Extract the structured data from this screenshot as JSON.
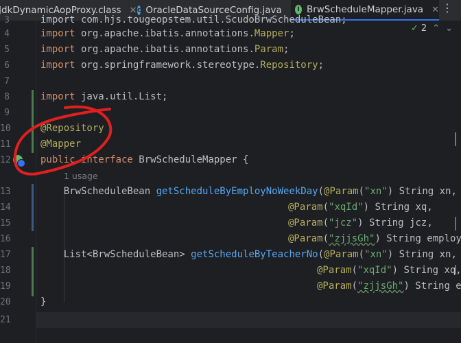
{
  "tabs": [
    {
      "label": "JdkDynamicAopProxy.class",
      "icon": "class-file-icon",
      "active": false
    },
    {
      "label": "OracleDataSourceConfig.java",
      "icon": "class-icon",
      "active": false
    },
    {
      "label": "BrwScheduleMapper.java",
      "icon": "interface-icon",
      "active": true
    }
  ],
  "menu_glyph": "⋮",
  "close_glyph": "✕",
  "inspection": {
    "check": "✓",
    "count": "2",
    "up": "⌃",
    "down": "⌄"
  },
  "usage_hint": "1 usage",
  "lines": {
    "l3": {
      "num": "3",
      "text": "import com.hjs.tougeopstem.util.ScudoBrwScheduleBean;"
    },
    "l4": {
      "num": "4",
      "kw": "import",
      "pkg": " org.apache.ibatis.annotations.",
      "cls": "Mapper",
      "end": ";"
    },
    "l5": {
      "num": "5",
      "kw": "import",
      "pkg": " org.apache.ibatis.annotations.",
      "cls": "Param",
      "end": ";"
    },
    "l6": {
      "num": "6",
      "kw": "import",
      "pkg": " org.springframework.stereotype.",
      "cls": "Repository",
      "end": ";"
    },
    "l7": {
      "num": "7"
    },
    "l8": {
      "num": "8",
      "kw": "import",
      "rest": " java.util.List;"
    },
    "l9": {
      "num": "9"
    },
    "l10": {
      "num": "10",
      "ann": "@Repository"
    },
    "l11": {
      "num": "11",
      "ann": "@Mapper"
    },
    "l12": {
      "num": "12",
      "kw1": "public",
      "kw2": " interface",
      "rest": " BrwScheduleMapper {"
    },
    "l13": {
      "num": "13",
      "pre": "    BrwScheduleBean ",
      "fn": "getScheduleByEmployNoWeekDay",
      "open": "(",
      "ann": "@Param",
      "p1": "(",
      "str": "\"xn\"",
      "p2": ") String xn,"
    },
    "l14": {
      "num": "14",
      "ann": "@Param",
      "p1": "(",
      "str": "\"xqId\"",
      "p2": ") String xq,"
    },
    "l15": {
      "num": "15",
      "ann": "@Param",
      "p1": "(",
      "str": "\"jcz\"",
      "p2": ") String jcz,"
    },
    "l16": {
      "num": "16",
      "ann": "@Param",
      "p1": "(",
      "str": "\"zjjsGh\"",
      "p2": ") String employ"
    },
    "l17": {
      "num": "17",
      "pre": "    List<BrwScheduleBean> ",
      "fn": "getScheduleByTeacherNo",
      "open": "(",
      "ann": "@Param",
      "p1": "(",
      "str": "\"xn\"",
      "p2": ") String xn,"
    },
    "l18": {
      "num": "18",
      "ann": "@Param",
      "p1": "(",
      "str": "\"xqId\"",
      "p2": ") String xq,"
    },
    "l19": {
      "num": "19",
      "ann": "@Param",
      "p1": "(",
      "str": "\"zjjsGh\"",
      "p2": ") String e"
    },
    "l20": {
      "num": "20",
      "text": "}"
    },
    "l21": {
      "num": "21"
    }
  },
  "colors": {
    "keyword": "#cf8e6d",
    "annotation": "#b3ae60",
    "string": "#6aab73",
    "method": "#56a8f5",
    "accent": "#3574f0",
    "red_mark": "#e02020"
  }
}
